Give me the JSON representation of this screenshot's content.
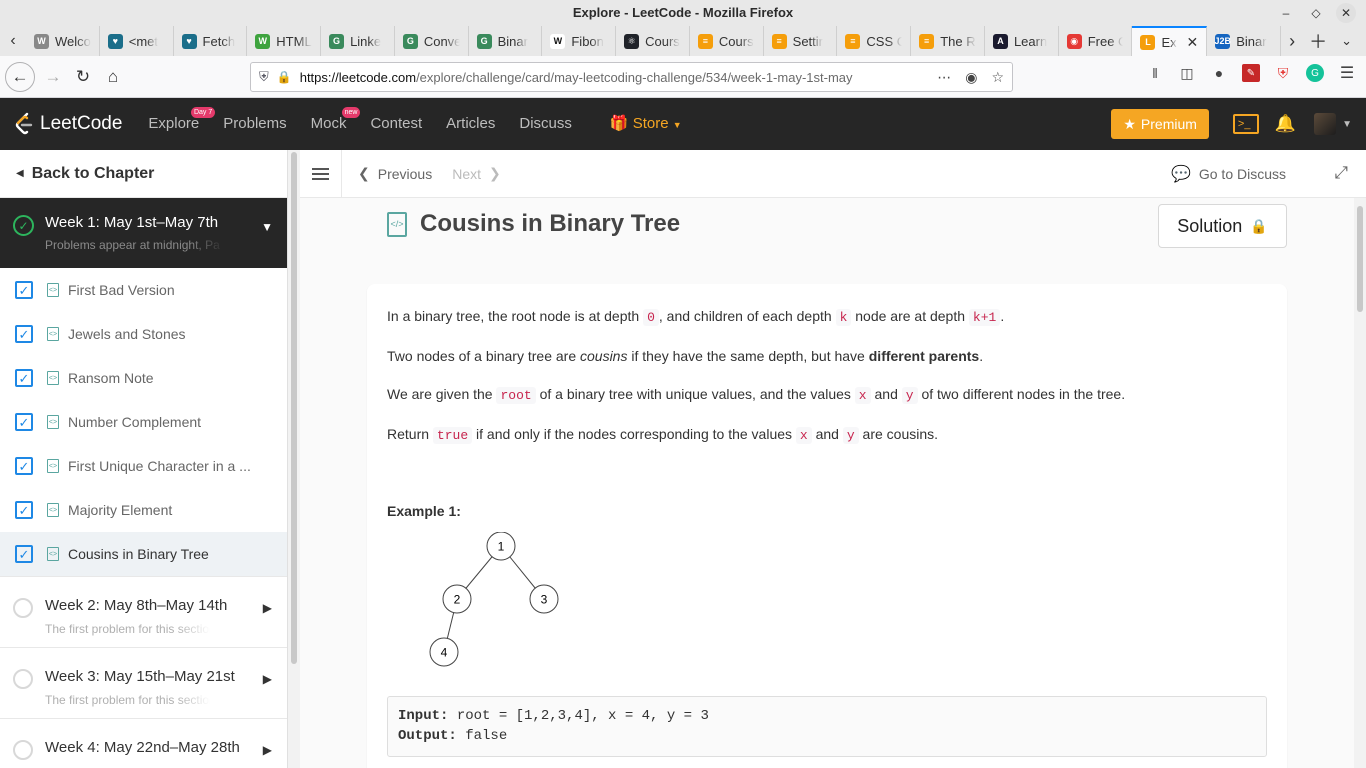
{
  "window": {
    "title": "Explore - LeetCode - Mozilla Firefox"
  },
  "tabs": [
    {
      "label": "Welco",
      "color": "#888888",
      "glyph": "W"
    },
    {
      "label": "<met",
      "color": "#1b6e8a",
      "glyph": "♥"
    },
    {
      "label": "Fetch",
      "color": "#1b6e8a",
      "glyph": "♥"
    },
    {
      "label": "HTML",
      "color": "#3ea33e",
      "glyph": "W"
    },
    {
      "label": "Linke",
      "color": "#3a8a5c",
      "glyph": "G"
    },
    {
      "label": "Conve",
      "color": "#3a8a5c",
      "glyph": "G"
    },
    {
      "label": "Binar",
      "color": "#3a8a5c",
      "glyph": "G"
    },
    {
      "label": "Fibon",
      "color": "#ffffff",
      "glyph": "W"
    },
    {
      "label": "Cours",
      "color": "#20232a",
      "glyph": "⚛"
    },
    {
      "label": "Cours",
      "color": "#f59e0b",
      "glyph": "≡"
    },
    {
      "label": "Settir",
      "color": "#f59e0b",
      "glyph": "≡"
    },
    {
      "label": "CSS C",
      "color": "#f59e0b",
      "glyph": "≡"
    },
    {
      "label": "The R",
      "color": "#f59e0b",
      "glyph": "≡"
    },
    {
      "label": "Learn",
      "color": "#1a1a2e",
      "glyph": "A"
    },
    {
      "label": "Free C",
      "color": "#e53935",
      "glyph": "◉"
    },
    {
      "label": "Ex",
      "color": "#f59e0b",
      "glyph": "L",
      "active": true
    },
    {
      "label": "Binar",
      "color": "#1565c0",
      "glyph": "J2B"
    }
  ],
  "navbar": {
    "url_host": "https://leetcode.com",
    "url_path": "/explore/challenge/card/may-leetcoding-challenge/534/week-1-may-1st-may"
  },
  "header": {
    "logo_text": "LeetCode",
    "nav": [
      {
        "label": "Explore",
        "badge": "Day 7"
      },
      {
        "label": "Problems"
      },
      {
        "label": "Mock",
        "badge": "new"
      },
      {
        "label": "Contest"
      },
      {
        "label": "Articles"
      },
      {
        "label": "Discuss"
      }
    ],
    "store_label": "Store",
    "premium_label": "Premium"
  },
  "sidebar": {
    "back_label": "Back to Chapter",
    "active_week": {
      "title": "Week 1: May 1st–May 7th",
      "desc": "Problems appear at midnight, Pa"
    },
    "problems": [
      {
        "label": "First Bad Version"
      },
      {
        "label": "Jewels and Stones"
      },
      {
        "label": "Ransom Note"
      },
      {
        "label": "Number Complement"
      },
      {
        "label": "First Unique Character in a ..."
      },
      {
        "label": "Majority Element"
      },
      {
        "label": "Cousins in Binary Tree",
        "current": true
      }
    ],
    "weeks": [
      {
        "title": "Week 2: May 8th–May 14th",
        "desc": "The first problem for this section w"
      },
      {
        "title": "Week 3: May 15th–May 21st",
        "desc": "The first problem for this section w"
      },
      {
        "title": "Week 4: May 22nd–May 28th",
        "desc": ""
      }
    ]
  },
  "content": {
    "prev_label": "Previous",
    "next_label": "Next",
    "goto_discuss": "Go to Discuss",
    "problem_title": "Cousins in Binary Tree",
    "solution_label": "Solution",
    "para1": {
      "t1": "In a binary tree, the root node is at depth ",
      "c1": "0",
      "t2": ", and children of each depth ",
      "c2": "k",
      "t3": " node are at depth ",
      "c3": "k+1",
      "t4": "."
    },
    "para2": {
      "t1": "Two nodes of a binary tree are ",
      "em": "cousins",
      "t2": " if they have the same depth, but have ",
      "strong": "different parents",
      "t3": "."
    },
    "para3": {
      "t1": "We are given the ",
      "c1": "root",
      "t2": " of a binary tree with unique values, and the values ",
      "c2": "x",
      "t3": " and ",
      "c3": "y",
      "t4": " of two different nodes in the tree."
    },
    "para4": {
      "t1": "Return ",
      "c1": "true",
      "t2": " if and only if the nodes corresponding to the values ",
      "c2": "x",
      "t3": " and ",
      "c3": "y",
      "t4": " are cousins."
    },
    "example_title": "Example 1:",
    "tree_nodes": [
      "1",
      "2",
      "3",
      "4"
    ],
    "input_label": "Input:",
    "input_value": " root = [1,2,3,4], x = 4, y = 3",
    "output_label": "Output:",
    "output_value": " false"
  }
}
